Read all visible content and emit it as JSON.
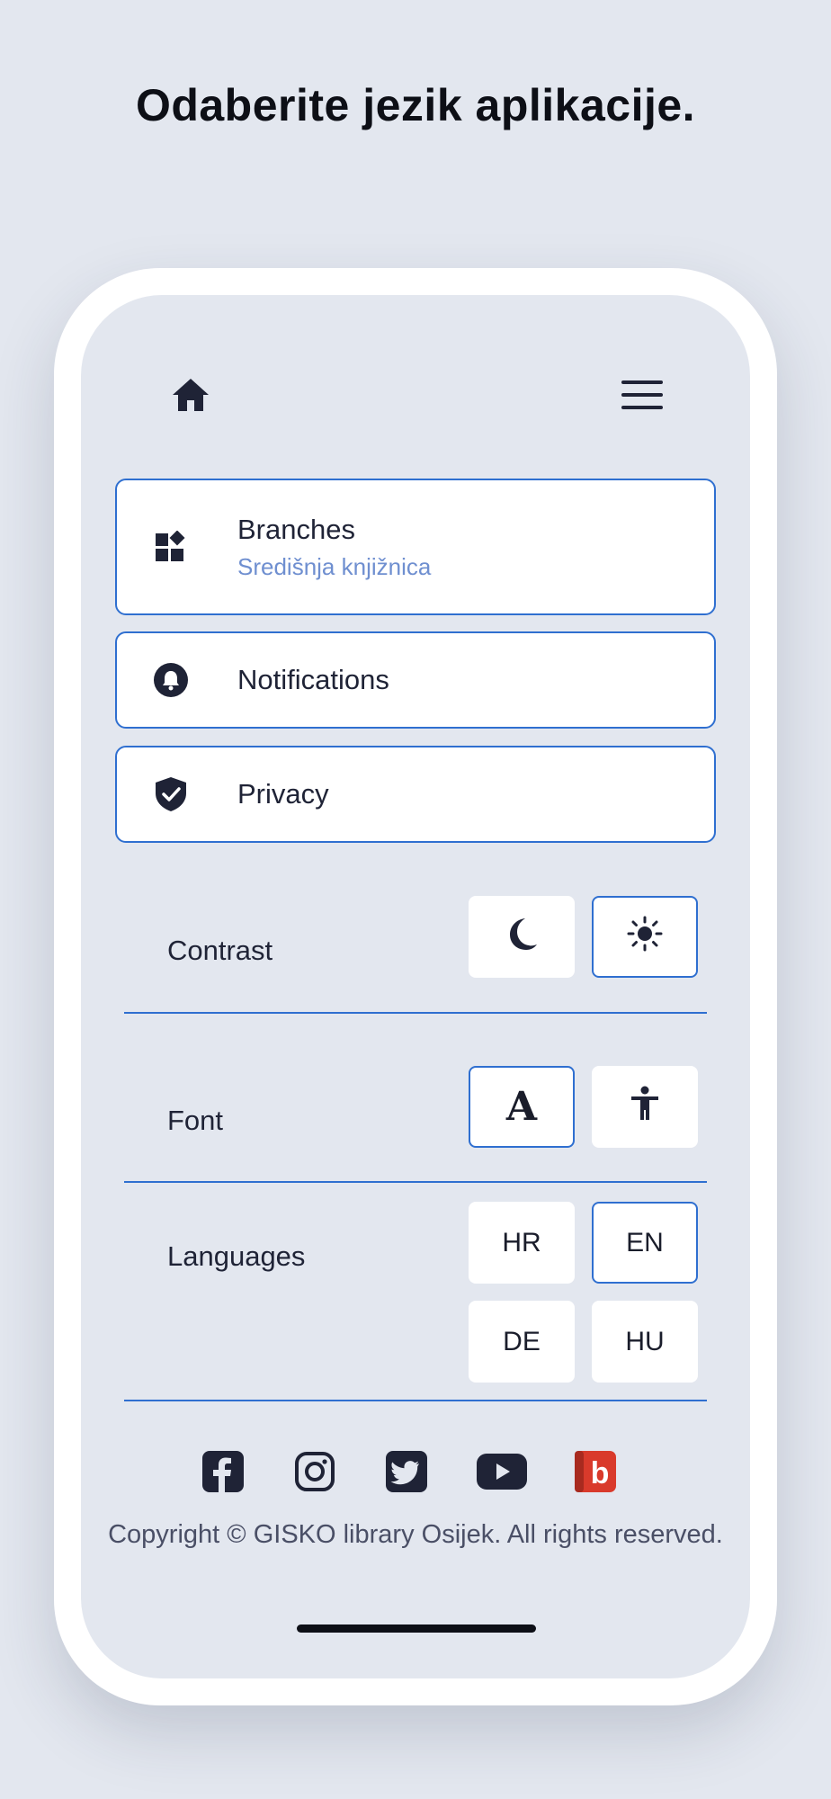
{
  "headline": "Odaberite jezik aplikacije.",
  "nav": {
    "home_icon": "home-icon",
    "menu_icon": "hamburger-menu-icon"
  },
  "cards": {
    "branches": {
      "title": "Branches",
      "subtitle": "Središnja knjižnica",
      "icon": "widgets-icon"
    },
    "notifications": {
      "title": "Notifications",
      "icon": "bell-icon"
    },
    "privacy": {
      "title": "Privacy",
      "icon": "shield-check-icon"
    }
  },
  "contrast": {
    "label": "Contrast",
    "options": [
      "moon-icon",
      "sun-icon"
    ],
    "selected": "sun-icon"
  },
  "font": {
    "label": "Font",
    "options": [
      "serif-letter-icon",
      "accessibility-icon"
    ],
    "font_glyph": "A",
    "selected": "serif-letter-icon"
  },
  "languages": {
    "label": "Languages",
    "options": [
      "HR",
      "EN",
      "DE",
      "HU"
    ],
    "selected": "EN"
  },
  "social": [
    "facebook-icon",
    "instagram-icon",
    "twitter-icon",
    "youtube-icon",
    "bibliotekarski-blog-icon"
  ],
  "social_blog_letter": "b",
  "footer": {
    "copyright": "Copyright © GISKO library Osijek. All rights reserved."
  },
  "colors": {
    "accent": "#2f6fd0",
    "background": "#e3e7ef",
    "text": "#1f2336",
    "subtitle": "#6f8fd0",
    "blog_red": "#d93a2b"
  }
}
